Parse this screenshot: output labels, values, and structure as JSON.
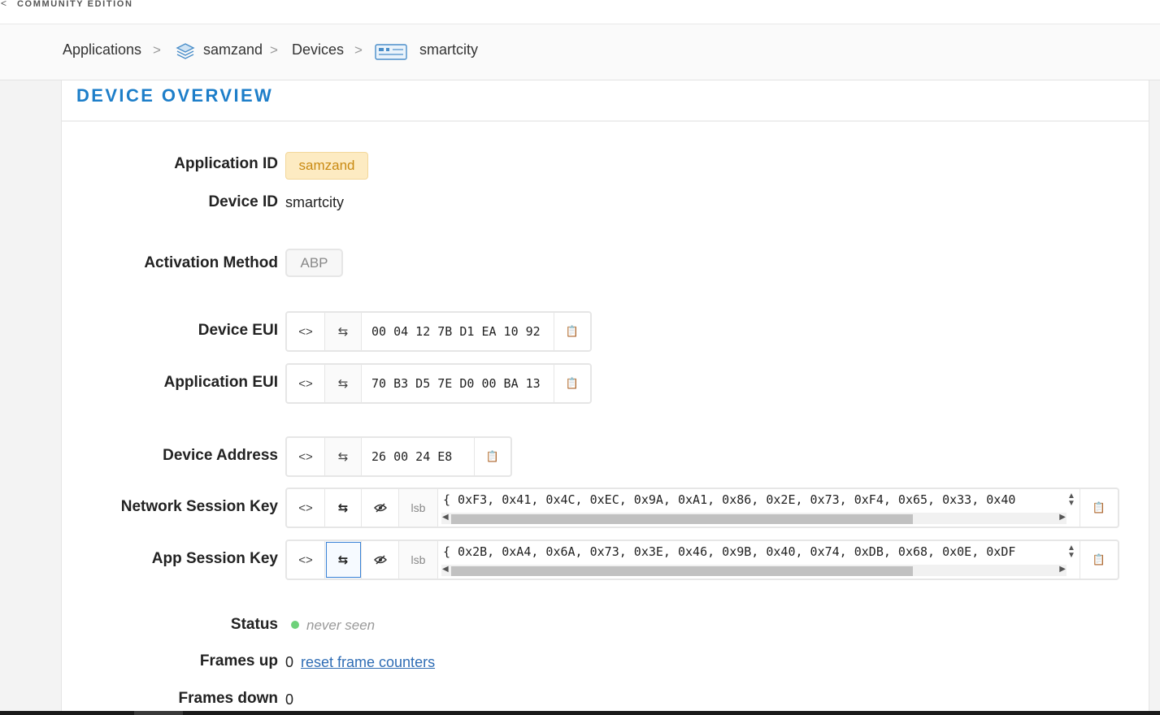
{
  "topbar": {
    "brand_subtitle": "COMMUNITY EDITION"
  },
  "breadcrumb": {
    "items": [
      {
        "label": "Applications"
      },
      {
        "label": "samzand",
        "icon": "layers-icon"
      },
      {
        "label": "Devices"
      },
      {
        "label": "smartcity",
        "icon": "device-board-icon"
      }
    ],
    "separator": ">"
  },
  "card": {
    "title": "DEVICE OVERVIEW"
  },
  "fields": {
    "application_id": {
      "label": "Application ID",
      "value": "samzand"
    },
    "device_id": {
      "label": "Device ID",
      "value": "smartcity"
    },
    "activation_method": {
      "label": "Activation Method",
      "value": "ABP"
    },
    "device_eui": {
      "label": "Device EUI",
      "value": "00 04 12 7B D1 EA 10 92"
    },
    "application_eui": {
      "label": "Application EUI",
      "value": "70 B3 D5 7E D0 00 BA 13"
    },
    "device_address": {
      "label": "Device Address",
      "value": "26 00 24 E8"
    },
    "network_session_key": {
      "label": "Network Session Key",
      "value": "{ 0xF3, 0x41, 0x4C, 0xEC, 0x9A, 0xA1, 0x86, 0x2E, 0x73, 0xF4, 0x65, 0x33, 0x40",
      "byte_order": "lsb"
    },
    "app_session_key": {
      "label": "App Session Key",
      "value": "{ 0x2B, 0xA4, 0x6A, 0x73, 0x3E, 0x46, 0x9B, 0x40, 0x74, 0xDB, 0x68, 0x0E, 0xDF",
      "byte_order": "lsb"
    },
    "status": {
      "label": "Status",
      "value": "never seen",
      "color": "#6ed17a"
    },
    "frames_up": {
      "label": "Frames up",
      "value": "0",
      "action": "reset frame counters"
    },
    "frames_down": {
      "label": "Frames down",
      "value": "0"
    }
  },
  "buttons": {
    "code_glyph": "<>",
    "swap_glyph": "⇆",
    "copy_glyph": "📋"
  },
  "colors": {
    "accent": "#1d7ec9",
    "app_id_bg": "#fdebc2",
    "link": "#2f6db5"
  }
}
